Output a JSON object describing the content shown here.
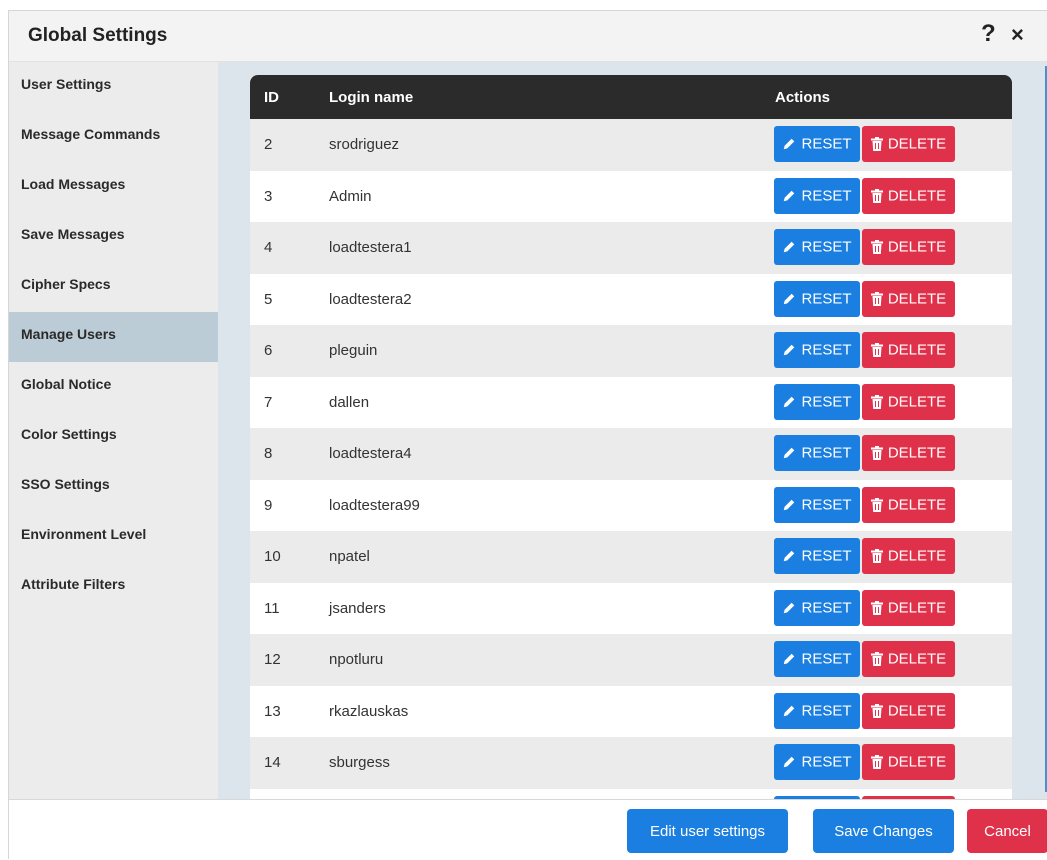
{
  "window": {
    "title": "Global Settings",
    "help_label": "?",
    "close_label": "×"
  },
  "sidebar": {
    "items": [
      {
        "label": "User Settings"
      },
      {
        "label": "Message Commands"
      },
      {
        "label": "Load Messages"
      },
      {
        "label": "Save Messages"
      },
      {
        "label": "Cipher Specs"
      },
      {
        "label": "Manage Users"
      },
      {
        "label": "Global Notice"
      },
      {
        "label": "Color Settings"
      },
      {
        "label": "SSO Settings"
      },
      {
        "label": "Environment Level"
      },
      {
        "label": "Attribute Filters"
      }
    ],
    "active": "Manage Users"
  },
  "table": {
    "headers": {
      "id": "ID",
      "login": "Login name",
      "actions": "Actions"
    },
    "reset_label": "RESET",
    "delete_label": "DELETE",
    "rows": [
      {
        "id": "2",
        "login": "srodriguez"
      },
      {
        "id": "3",
        "login": "Admin"
      },
      {
        "id": "4",
        "login": "loadtestera1"
      },
      {
        "id": "5",
        "login": "loadtestera2"
      },
      {
        "id": "6",
        "login": "pleguin"
      },
      {
        "id": "7",
        "login": "dallen"
      },
      {
        "id": "8",
        "login": "loadtestera4"
      },
      {
        "id": "9",
        "login": "loadtestera99"
      },
      {
        "id": "10",
        "login": "npatel"
      },
      {
        "id": "11",
        "login": "jsanders"
      },
      {
        "id": "12",
        "login": "npotluru"
      },
      {
        "id": "13",
        "login": "rkazlauskas"
      },
      {
        "id": "14",
        "login": "sburgess"
      },
      {
        "id": "",
        "login": ""
      }
    ]
  },
  "footer": {
    "edit_label": "Edit user settings",
    "save_label": "Save Changes",
    "cancel_label": "Cancel"
  },
  "colors": {
    "primary": "#1a7fe0",
    "danger": "#e0314b",
    "header": "#2b2b2b",
    "active_nav": "#bcccd6"
  },
  "icons": {
    "reset": "pencil-icon",
    "delete": "trash-icon"
  }
}
